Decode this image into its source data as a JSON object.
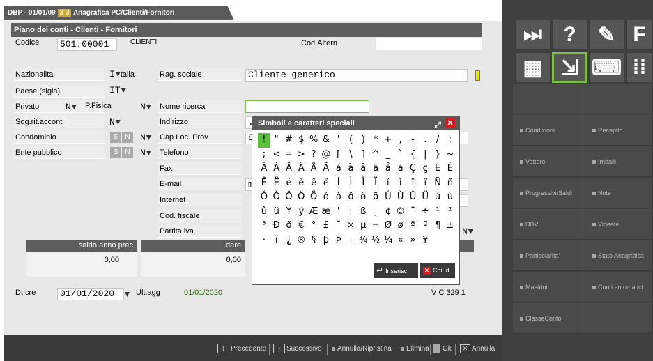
{
  "tab": {
    "prefix": "DBP - 01/01/09",
    "num": "3 3",
    "title": "Anagrafica PC/Clienti/Fornitori"
  },
  "header": {
    "title": "Piano dei conti - Clienti - Fornitori"
  },
  "codice": {
    "label": "Codice",
    "value": "501.00001",
    "desc": "CLIENTI",
    "alt_label": "Cod.Altern"
  },
  "fields": {
    "nazionalita": {
      "label": "Nazionalita'",
      "value": "I",
      "text": "talia"
    },
    "paese": {
      "label": "Paese (sigla)",
      "value": "IT"
    },
    "privato": {
      "label": "Privato",
      "value": "N",
      "pfisica_label": "P.Fisica",
      "pfisica_value": "N"
    },
    "sogrit": {
      "label": "Sog.rit.accont",
      "value": "N"
    },
    "condominio": {
      "label": "Condominio",
      "s": "S",
      "n": "N",
      "value": "N"
    },
    "ente": {
      "label": "Ente pubblico",
      "s": "S",
      "n": "N",
      "value": "N"
    },
    "ragsoc": {
      "label": "Rag. sociale",
      "value": "Cliente generico"
    },
    "nomeric": {
      "label": "Nome ricerca"
    },
    "indirizzo": {
      "label": "Indirizzo",
      "value": "."
    },
    "cap": {
      "label": "Cap Loc. Prov",
      "value": "8"
    },
    "telefono": {
      "label": "Telefono"
    },
    "fax": {
      "label": "Fax"
    },
    "email": {
      "label": "E-mail",
      "value": "m"
    },
    "internet": {
      "label": "Internet"
    },
    "codfiscale": {
      "label": "Cod. fiscale"
    },
    "partitaiva": {
      "label": "Partita iva",
      "value": "N"
    }
  },
  "table": {
    "h1": "saldo anno prec",
    "h2": "dare",
    "v1": "0,00",
    "v2": "0,00"
  },
  "dates": {
    "dtcre_label": "Dt.cre",
    "dtcre": "01/01/2020",
    "ultagg_label": "Ult.agg",
    "ultagg": "01/01/2020",
    "vc": "V C 329 1"
  },
  "popup": {
    "title": "Simboli e caratteri speciali",
    "rows": [
      [
        "!",
        "\"",
        "#",
        "$",
        "%",
        "&",
        "'",
        "(",
        ")",
        "*",
        "+",
        ",",
        "-",
        ".",
        "/",
        ":"
      ],
      [
        ";",
        "<",
        "=",
        ">",
        "?",
        "@",
        "[",
        "\\",
        "]",
        "^",
        "_",
        "`",
        "{",
        "|",
        "}",
        "~"
      ],
      [
        "Á",
        "À",
        "Â",
        "Ä",
        "Å",
        "Ã",
        "á",
        "à",
        "â",
        "ä",
        "å",
        "ã",
        "Ç",
        "ç",
        "É",
        "È"
      ],
      [
        "Ê",
        "Ë",
        "é",
        "è",
        "ê",
        "ë",
        "Í",
        "Ì",
        "Î",
        "Ï",
        "í",
        "ì",
        "î",
        "ï",
        "Ñ",
        "ñ"
      ],
      [
        "Ó",
        "Ò",
        "Ô",
        "Ö",
        "Õ",
        "ó",
        "ò",
        "ô",
        "ö",
        "õ",
        "Ú",
        "Ù",
        "Û",
        "Ü",
        "ú",
        "ù"
      ],
      [
        "û",
        "ü",
        "Ý",
        "ý",
        "Æ",
        "æ",
        "'",
        "¦",
        "ß",
        "¸",
        "¢",
        "©",
        "¨",
        "÷",
        "¹",
        "²"
      ],
      [
        "³",
        "Ð",
        "ð",
        "€",
        "°",
        "£",
        "˜",
        "×",
        "µ",
        "¬",
        "Ø",
        "ø",
        "ª",
        "º",
        "¶",
        "±"
      ],
      [
        "·",
        "ĭ",
        "¿",
        "®",
        "§",
        "þ",
        "Þ",
        "-",
        "¾",
        "½",
        "¼",
        "«",
        "»",
        "¥",
        "",
        ""
      ]
    ],
    "insert": "Inserisc",
    "close": "Chiud"
  },
  "right": {
    "grid": [
      [
        "Condizioni",
        "Recapito"
      ],
      [
        "Vettore",
        "Imballi"
      ],
      [
        "Progressivi/Saldi",
        "Note"
      ],
      [
        "DBV",
        "Videate"
      ],
      [
        "Particolarita'",
        "Stato Anagrafica"
      ],
      [
        "Mastrini",
        "Conti automatici"
      ],
      [
        "ClasseConto",
        ""
      ]
    ]
  },
  "bottom": {
    "prec": "Precedente",
    "succ": "Successivo",
    "annulla_ripr": "Annulla/Ripristina",
    "elimina": "Elimina",
    "ok": "Ok",
    "annulla": "Annulla"
  }
}
